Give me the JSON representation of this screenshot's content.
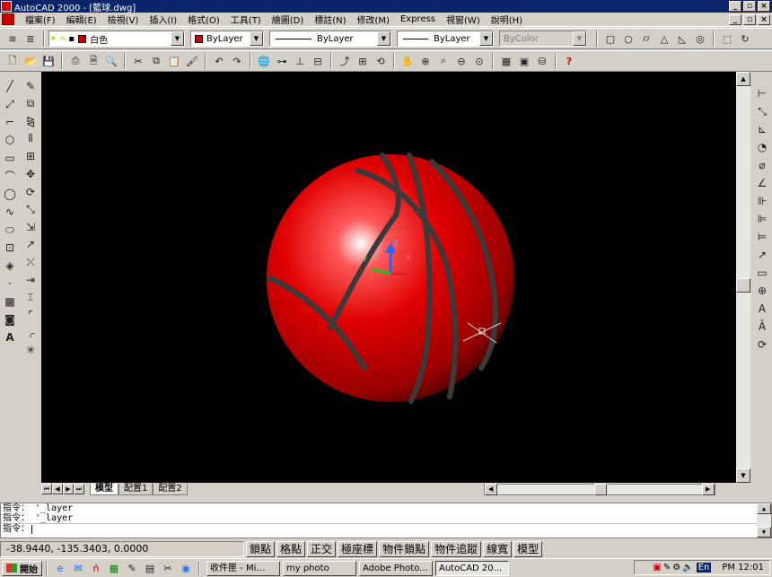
{
  "window": {
    "title": "AutoCAD 2000 - [籃球.dwg]"
  },
  "menu": [
    "檔案(F)",
    "編輯(E)",
    "檢視(V)",
    "插入(I)",
    "格式(O)",
    "工具(T)",
    "繪圖(D)",
    "標註(N)",
    "修改(M)",
    "Express",
    "視窗(W)",
    "說明(H)"
  ],
  "layers": {
    "current": "白色",
    "color": "ByLayer",
    "linetype": "ByLayer",
    "lineweight": "ByLayer",
    "plotstyle": "ByColor"
  },
  "colors": {
    "ball": "#d60000",
    "canvas": "#000000",
    "titlebar": "#0a246a"
  },
  "tabs": [
    "模型",
    "配置1",
    "配置2"
  ],
  "command": {
    "lines": [
      "指令： '_layer",
      "指令： '_layer"
    ],
    "prompt": "指令："
  },
  "status": {
    "coords": "-38.9440, -135.3403, 0.0000",
    "buttons": [
      "鎖點",
      "格點",
      "正交",
      "極座標",
      "物件鎖點",
      "物件追蹤",
      "線寬",
      "模型"
    ]
  },
  "taskbar": {
    "start": "開始",
    "tasks": [
      "收件匣 - Mi...",
      "my photo",
      "Adobe Photo...",
      "AutoCAD 20..."
    ],
    "clock": "PM 12:01",
    "lang": "En"
  }
}
